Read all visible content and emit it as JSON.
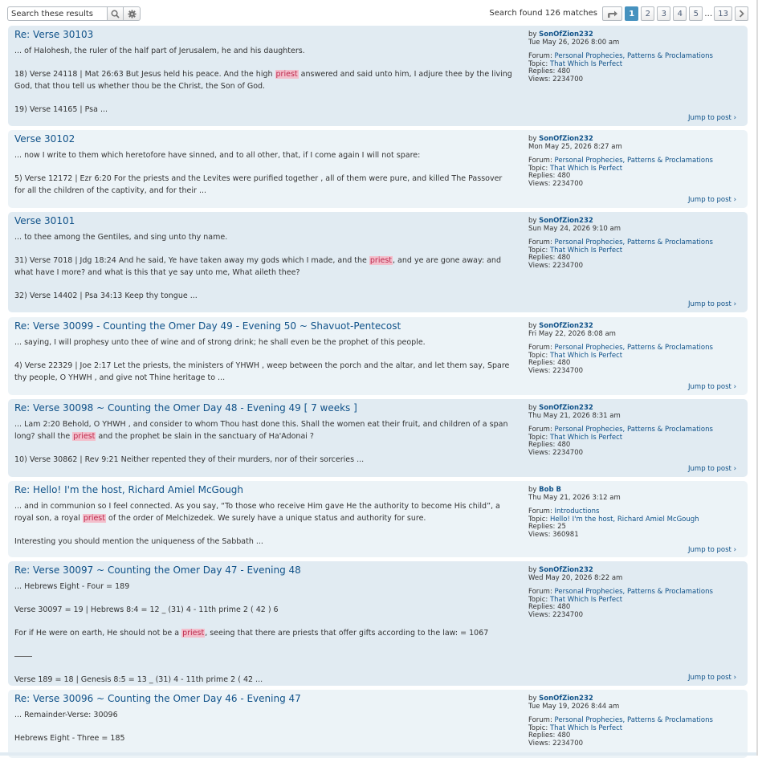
{
  "search": {
    "placeholder": "Search these results"
  },
  "icons": {
    "search": "search-icon",
    "settings": "gear-icon",
    "jump": "share-arrow-icon",
    "next": "chevron-right-icon"
  },
  "matches_text": "Search found 126 matches",
  "pagination": {
    "pages": [
      "1",
      "2",
      "3",
      "4",
      "5"
    ],
    "ellipsis": "…",
    "last": "13",
    "current": "1"
  },
  "colors": {
    "accent": "#4692bf",
    "link": "#105289",
    "highlight_bg": "#f3bfcc",
    "highlight_fg": "#bc2a4d",
    "row1": "#e1ebf2",
    "row2": "#ecf3f7"
  },
  "labels": {
    "by": "by",
    "forum": "Forum:",
    "topic": "Topic:",
    "replies": "Replies:",
    "views": "Views:",
    "jump": "Jump to post ›"
  },
  "posts": [
    {
      "title": "Re: Verse 30103",
      "author": "SonOfZion232",
      "date": "Tue May 26, 2026 8:00 am",
      "forum": "Personal Prophecies, Patterns & Proclamations",
      "topic": "That Which Is Perfect",
      "replies": "480",
      "views": "2234700",
      "paragraphs": [
        [
          "... of Halohesh, the ruler of the half part of Jerusalem, he and his daughters."
        ],
        [
          "18) Verse 24118 | Mat 26:63 But Jesus held his peace. And the high ",
          "priest",
          " answered and said unto him, I adjure thee by the living God, that thou tell us whether thou be the Christ, the Son of God."
        ],
        [
          "19) Verse 14165 | Psa ..."
        ]
      ]
    },
    {
      "title": "Verse 30102",
      "author": "SonOfZion232",
      "date": "Mon May 25, 2026 8:27 am",
      "forum": "Personal Prophecies, Patterns & Proclamations",
      "topic": "That Which Is Perfect",
      "replies": "480",
      "views": "2234700",
      "paragraphs": [
        [
          "... now I write to them which heretofore have sinned, and to all other, that, if I come again I will not spare:"
        ],
        [
          "5) Verse 12172 | Ezr 6:20 For the priests and the Levites were purified together , all of them were pure, and killed The Passover for all the children of the captivity, and for their ..."
        ]
      ]
    },
    {
      "title": "Verse 30101",
      "author": "SonOfZion232",
      "date": "Sun May 24, 2026 9:10 am",
      "forum": "Personal Prophecies, Patterns & Proclamations",
      "topic": "That Which Is Perfect",
      "replies": "480",
      "views": "2234700",
      "paragraphs": [
        [
          "... to thee among the Gentiles, and sing unto thy name."
        ],
        [
          "31) Verse 7018 | Jdg 18:24 And he said, Ye have taken away my gods which I made, and the ",
          "priest",
          ", and ye are gone away: and what have I more? and what is this that ye say unto me, What aileth thee?"
        ],
        [
          "32) Verse 14402 | Psa 34:13 Keep thy tongue ..."
        ]
      ]
    },
    {
      "title": "Re: Verse 30099 - Counting the Omer Day 49 - Evening 50 ~ Shavuot-Pentecost",
      "author": "SonOfZion232",
      "date": "Fri May 22, 2026 8:08 am",
      "forum": "Personal Prophecies, Patterns & Proclamations",
      "topic": "That Which Is Perfect",
      "replies": "480",
      "views": "2234700",
      "paragraphs": [
        [
          "... saying, I will prophesy unto thee of wine and of strong drink; he shall even be the prophet of this people."
        ],
        [
          "4) Verse 22329 | Joe 2:17 Let the priests, the ministers of YHWH , weep between the porch and the altar, and let them say, Spare thy people, O YHWH , and give not Thine heritage to ..."
        ]
      ]
    },
    {
      "title": "Re: Verse 30098 ~ Counting the Omer Day 48 - Evening 49 [ 7 weeks ]",
      "author": "SonOfZion232",
      "date": "Thu May 21, 2026 8:31 am",
      "forum": "Personal Prophecies, Patterns & Proclamations",
      "topic": "That Which Is Perfect",
      "replies": "480",
      "views": "2234700",
      "paragraphs": [
        [
          "... Lam 2:20 Behold, O YHWH , and consider to whom Thou hast done this. Shall the women eat their fruit, and children of a span long? shall the ",
          "priest",
          " and the prophet be slain in the sanctuary of Ha'Adonai ?"
        ],
        [
          "10) Verse 30862 | Rev 9:21 Neither repented they of their murders, nor of their sorceries ..."
        ]
      ]
    },
    {
      "title": "Re: Hello! I'm the host, Richard Amiel McGough",
      "author": "Bob B",
      "date": "Thu May 21, 2026 3:12 am",
      "forum": "Introductions",
      "topic": "Hello! I'm the host, Richard Amiel McGough",
      "replies": "25",
      "views": "360981",
      "paragraphs": [
        [
          "... and in communion so I feel connected. As you say, “To those who receive Him gave He the authority to become His child”, a royal son, a royal ",
          "priest",
          " of the order of Melchizedek. We surely have a unique status and authority for sure."
        ],
        [
          "Interesting you should mention the uniqueness of the Sabbath ..."
        ]
      ]
    },
    {
      "title": "Re: Verse 30097 ~ Counting the Omer Day 47 - Evening 48",
      "author": "SonOfZion232",
      "date": "Wed May 20, 2026 8:22 am",
      "forum": "Personal Prophecies, Patterns & Proclamations",
      "topic": "That Which Is Perfect",
      "replies": "480",
      "views": "2234700",
      "paragraphs": [
        [
          "... Hebrews Eight - Four = 189"
        ],
        [
          "Verse 30097 = 19 | Hebrews 8:4 = 12 _ (31) 4 - 11th prime 2 ( 42 ) 6"
        ],
        [
          "For if He were on earth, He should not be a ",
          "priest",
          ", seeing that there are priests that offer gifts according to the law: = 1067"
        ],
        [
          "~HR~"
        ],
        [
          "Verse 189 = 18 | Genesis 8:5 = 13 _ (31) 4 - 11th prime 2 ( 42 ..."
        ]
      ]
    },
    {
      "title": "Re: Verse 30096 ~ Counting the Omer Day 46 - Evening 47",
      "author": "SonOfZion232",
      "date": "Tue May 19, 2026 8:44 am",
      "forum": "Personal Prophecies, Patterns & Proclamations",
      "topic": "That Which Is Perfect",
      "replies": "480",
      "views": "2234700",
      "paragraphs": [
        [
          "... Remainder-Verse: 30096"
        ],
        [
          "Hebrews Eight - Three = 185"
        ]
      ]
    }
  ]
}
